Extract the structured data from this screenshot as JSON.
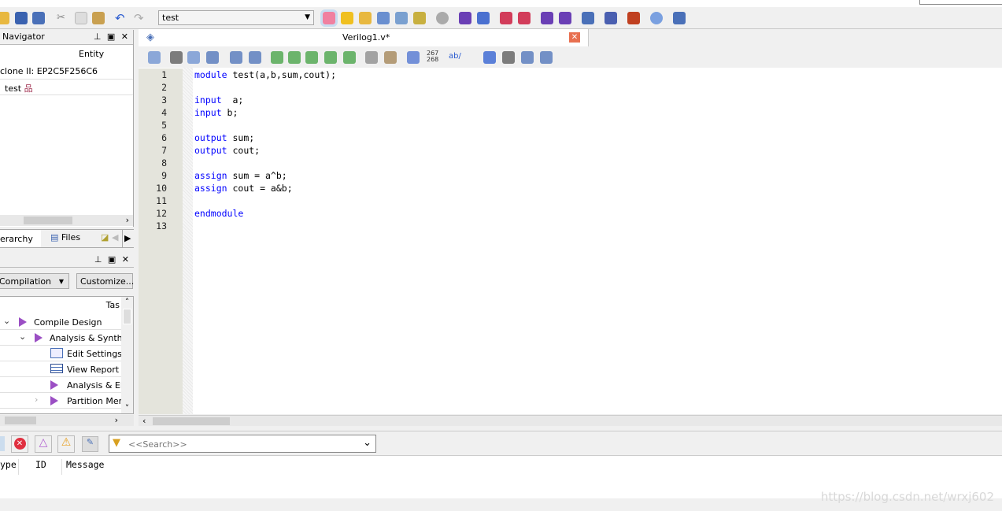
{
  "toolbar": {
    "revision_combo": "test",
    "left_icons": [
      "open-icon",
      "save-icon",
      "save-all-icon",
      "cut-icon",
      "copy-icon",
      "paste-icon",
      "undo-icon",
      "redo-icon"
    ],
    "right_icons": [
      "pin-planner-icon",
      "assignment-editor-icon",
      "pin-icon",
      "chip-planner-icon",
      "design-partition-icon",
      "logic-lock-icon",
      "stop-icon",
      "start-compilation-icon",
      "analysis-synthesis-icon",
      "timing-analyzer-icon",
      "timequest-icon",
      "simulation-icon",
      "simulation-functional-icon",
      "programmer-icon",
      "chip-editor-icon",
      "netlist-viewer-icon",
      "help-icon",
      "feedback-icon"
    ],
    "colors": {
      "stop": "#9e9e9e",
      "run": "#6a3fb5",
      "timer": "#d23c5a"
    }
  },
  "navigator": {
    "title": "Navigator",
    "column": "Entity",
    "device": "clone II: EP2C5F256C6",
    "top_entity": "test",
    "tabs": [
      "erarchy",
      "Files"
    ]
  },
  "tasks": {
    "flow": "Compilation",
    "customize": "Customize...",
    "column": "Tas",
    "items": [
      {
        "label": "Compile Design",
        "icon": "run-icon",
        "expander": "expanded"
      },
      {
        "label": "Analysis & Synthes",
        "icon": "run-icon",
        "expander": "expanded"
      },
      {
        "label": "Edit Settings",
        "icon": "settings-icon"
      },
      {
        "label": "View Report",
        "icon": "report-icon"
      },
      {
        "label": "Analysis & Elal",
        "icon": "run-icon"
      },
      {
        "label": "Partition Merg",
        "icon": "run-icon",
        "expander": "collapsed"
      }
    ]
  },
  "editor": {
    "tab_title": "Verilog1.v*",
    "line_numbers": [
      "1",
      "2",
      "3",
      "4",
      "5",
      "6",
      "7",
      "8",
      "9",
      "10",
      "11",
      "12",
      "13"
    ],
    "lines": [
      [
        "module",
        " test(a,b,sum,cout);"
      ],
      [
        "",
        ""
      ],
      [
        "input",
        "  a;"
      ],
      [
        "input",
        " b;"
      ],
      [
        "",
        ""
      ],
      [
        "output",
        " sum;"
      ],
      [
        "output",
        " cout;"
      ],
      [
        "",
        ""
      ],
      [
        "assign",
        " sum = a^b;"
      ],
      [
        "assign",
        " cout = a&b;"
      ],
      [
        "",
        ""
      ],
      [
        "endmodule",
        ""
      ],
      [
        "",
        ""
      ]
    ],
    "toolbar_counter": [
      "267",
      "268"
    ],
    "toolbar_ab": "ab/"
  },
  "messages": {
    "search_placeholder": "<<Search>>",
    "columns": [
      "ype",
      "ID",
      "Message"
    ]
  },
  "watermark": "https://blog.csdn.net/wrxj602"
}
